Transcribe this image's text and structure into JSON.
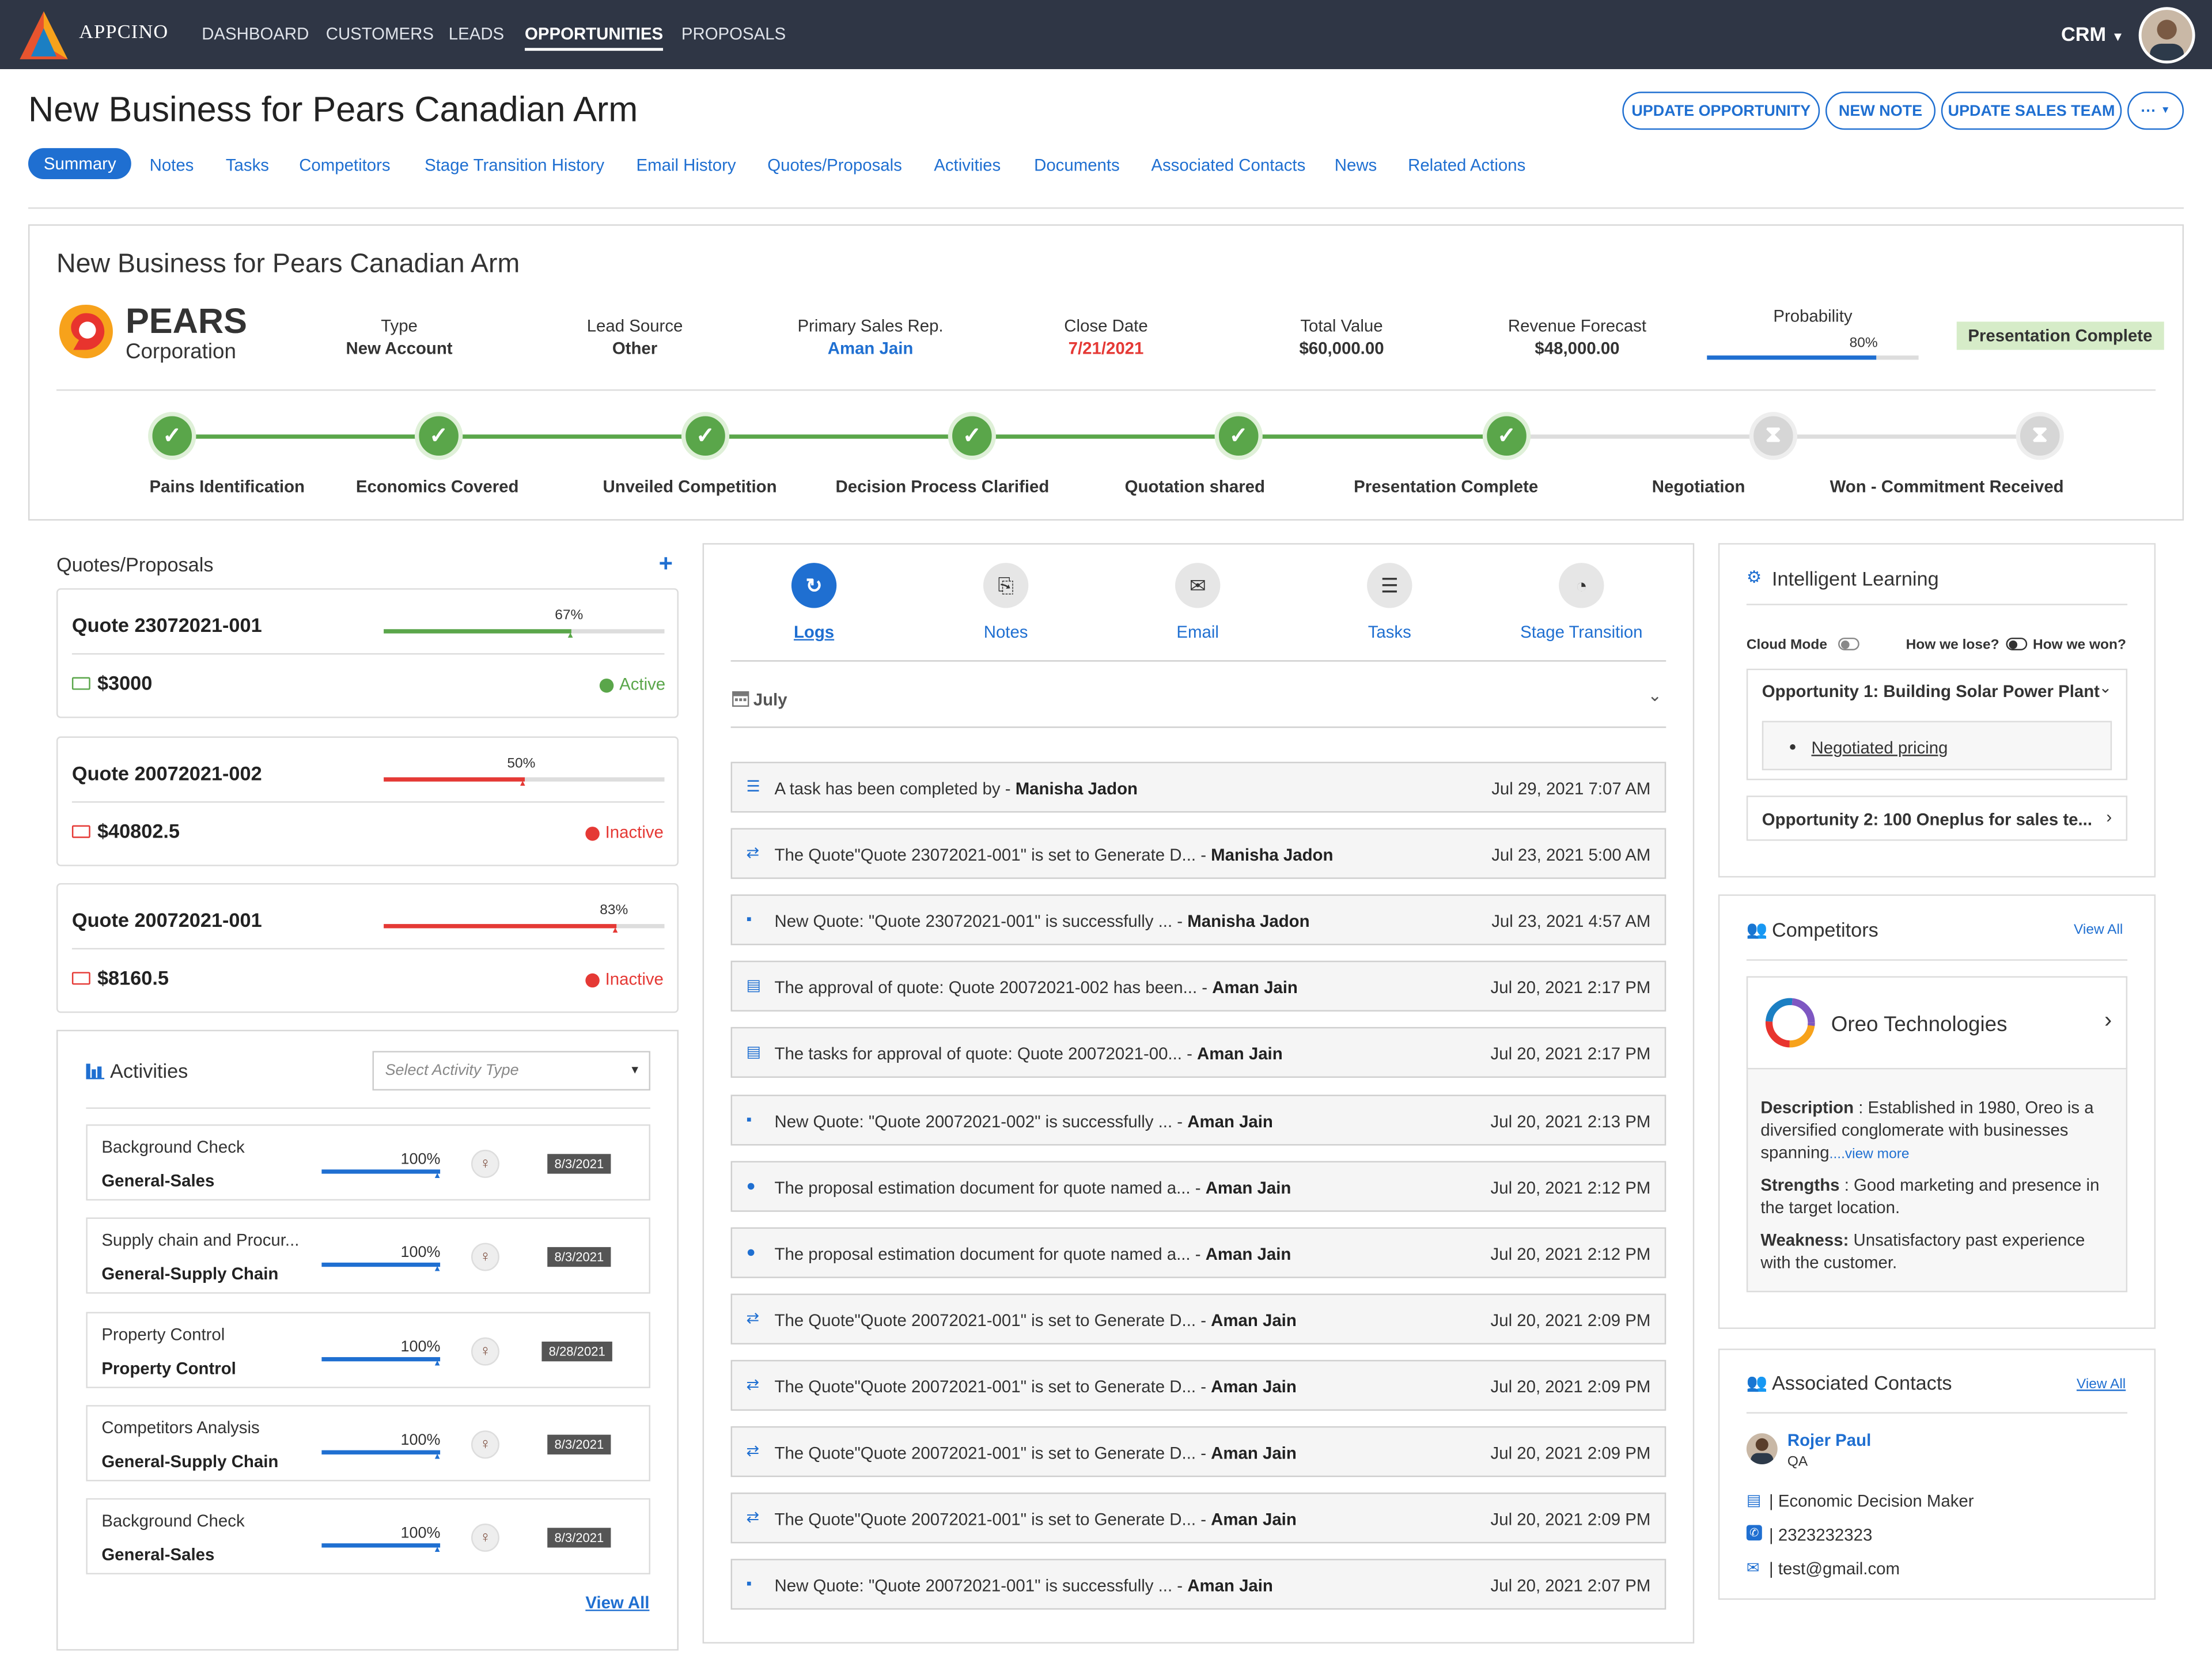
{
  "app": {
    "brand": "APPCINO",
    "crm_label": "CRM"
  },
  "nav": [
    "DASHBOARD",
    "CUSTOMERS",
    "LEADS",
    "OPPORTUNITIES",
    "PROPOSALS"
  ],
  "header": {
    "title": "New Business for Pears Canadian Arm",
    "buttons": [
      "UPDATE OPPORTUNITY",
      "NEW NOTE",
      "UPDATE SALES TEAM",
      "···"
    ]
  },
  "tabs": [
    "Summary",
    "Notes",
    "Tasks",
    "Competitors",
    "Stage Transition History",
    "Email History",
    "Quotes/Proposals",
    "Activities",
    "Documents",
    "Associated Contacts",
    "News",
    "Related Actions"
  ],
  "summary": {
    "title": "New Business for Pears Canadian Arm",
    "company": {
      "name": "PEARS",
      "sub": "Corporation"
    },
    "type": {
      "label": "Type",
      "value": "New Account"
    },
    "lead_source": {
      "label": "Lead Source",
      "value": "Other"
    },
    "rep": {
      "label": "Primary Sales Rep.",
      "value": "Aman Jain"
    },
    "close_date": {
      "label": "Close Date",
      "value": "7/21/2021"
    },
    "total_value": {
      "label": "Total Value",
      "value": "$60,000.00"
    },
    "revenue": {
      "label": "Revenue Forecast",
      "value": "$48,000.00"
    },
    "probability": {
      "label": "Probability",
      "value": "80%",
      "fraction": 0.8
    },
    "status_badge": "Presentation Complete",
    "stages": [
      {
        "label": "Pains Identification",
        "done": true
      },
      {
        "label": "Economics Covered",
        "done": true
      },
      {
        "label": "Unveiled Competition",
        "done": true
      },
      {
        "label": "Decision Process Clarified",
        "done": true
      },
      {
        "label": "Quotation shared",
        "done": true
      },
      {
        "label": "Presentation Complete",
        "done": true
      },
      {
        "label": "Negotiation",
        "done": false
      },
      {
        "label": "Won - Commitment Received",
        "done": false
      }
    ]
  },
  "quotes": {
    "title": "Quotes/Proposals",
    "items": [
      {
        "name": "Quote 23072021-001",
        "pct": "67%",
        "frac": 0.67,
        "amount": "$3000",
        "status": "Active",
        "color": "#5aa64a"
      },
      {
        "name": "Quote 20072021-002",
        "pct": "50%",
        "frac": 0.5,
        "amount": "$40802.5",
        "status": "Inactive",
        "color": "#e53935"
      },
      {
        "name": "Quote 20072021-001",
        "pct": "83%",
        "frac": 0.83,
        "amount": "$8160.5",
        "status": "Inactive",
        "color": "#e53935"
      }
    ]
  },
  "activities": {
    "title": "Activities",
    "select_placeholder": "Select Activity Type",
    "view_all": "View All",
    "items": [
      {
        "name": "Background Check",
        "type": "General-Sales",
        "pct": "100%",
        "date": "8/3/2021"
      },
      {
        "name": "Supply chain and Procur...",
        "type": "General-Supply Chain",
        "pct": "100%",
        "date": "8/3/2021"
      },
      {
        "name": "Property Control",
        "type": "Property Control",
        "pct": "100%",
        "date": "8/28/2021"
      },
      {
        "name": "Competitors Analysis",
        "type": "General-Supply Chain",
        "pct": "100%",
        "date": "8/3/2021"
      },
      {
        "name": "Background Check",
        "type": "General-Sales",
        "pct": "100%",
        "date": "8/3/2021"
      }
    ]
  },
  "logs": {
    "tabs": [
      "Logs",
      "Notes",
      "Email",
      "Tasks",
      "Stage Transition"
    ],
    "month": "July",
    "items": [
      {
        "text": "A task has been completed by  - ",
        "who": "Manisha Jadon",
        "time": "Jul 29, 2021 7:07 AM",
        "icon": "☰"
      },
      {
        "text": "The Quote\"Quote 23072021-001\" is set to Generate D... - ",
        "who": "Manisha Jadon",
        "time": "Jul 23, 2021 5:00 AM",
        "icon": "⇄"
      },
      {
        "text": "New Quote:  \"Quote 23072021-001\"  is successfully ... - ",
        "who": "Manisha Jadon",
        "time": "Jul 23, 2021 4:57 AM",
        "icon": "▪"
      },
      {
        "text": "The approval of quote: Quote 20072021-002 has been... - ",
        "who": "Aman Jain",
        "time": "Jul 20, 2021 2:17 PM",
        "icon": "▤"
      },
      {
        "text": "The tasks for approval of quote: Quote 20072021-00... - ",
        "who": "Aman Jain",
        "time": "Jul 20, 2021 2:17 PM",
        "icon": "▤"
      },
      {
        "text": "New Quote:  \"Quote 20072021-002\"  is successfully ... - ",
        "who": "Aman Jain",
        "time": "Jul 20, 2021 2:13 PM",
        "icon": "▪"
      },
      {
        "text": "The proposal estimation document for quote named a... - ",
        "who": "Aman Jain",
        "time": "Jul 20, 2021 2:12 PM",
        "icon": "●"
      },
      {
        "text": "The proposal estimation document for quote named a... - ",
        "who": "Aman Jain",
        "time": "Jul 20, 2021 2:12 PM",
        "icon": "●"
      },
      {
        "text": "The Quote\"Quote 20072021-001\" is set to Generate D... - ",
        "who": "Aman Jain",
        "time": "Jul 20, 2021 2:09 PM",
        "icon": "⇄"
      },
      {
        "text": "The Quote\"Quote 20072021-001\" is set to Generate D... - ",
        "who": "Aman Jain",
        "time": "Jul 20, 2021 2:09 PM",
        "icon": "⇄"
      },
      {
        "text": "The Quote\"Quote 20072021-001\" is set to Generate D... - ",
        "who": "Aman Jain",
        "time": "Jul 20, 2021 2:09 PM",
        "icon": "⇄"
      },
      {
        "text": "The Quote\"Quote 20072021-001\" is set to Generate D... - ",
        "who": "Aman Jain",
        "time": "Jul 20, 2021 2:09 PM",
        "icon": "⇄"
      },
      {
        "text": "New Quote:  \"Quote 20072021-001\"  is successfully ... - ",
        "who": "Aman Jain",
        "time": "Jul 20, 2021 2:07 PM",
        "icon": "▪"
      }
    ]
  },
  "intelligent": {
    "title": "Intelligent Learning",
    "cloud_mode": "Cloud Mode",
    "lose": "How we lose?",
    "won": "How we won?",
    "opp1": "Opportunity 1: Building Solar Power Plant",
    "opp1_item": "Negotiated pricing",
    "opp2": "Opportunity 2: 100 Oneplus for sales te..."
  },
  "competitors": {
    "title": "Competitors",
    "view_all": "View All",
    "name": "Oreo Technologies",
    "desc_label": "Description",
    "desc": " : Established in 1980, Oreo is a diversified conglomerate with businesses spanning",
    "view_more": "....view more",
    "str_label": "Strengths",
    "str": " : Good marketing and presence in the target location.",
    "weak_label": "Weakness:",
    "weak": " Unsatisfactory past experience with the customer."
  },
  "contacts": {
    "title": "Associated Contacts",
    "view_all": "View All",
    "name": "Rojer Paul",
    "role": "QA",
    "decision": "| Economic Decision Maker",
    "phone": "| 2323232323",
    "email": "| test@gmail.com"
  }
}
